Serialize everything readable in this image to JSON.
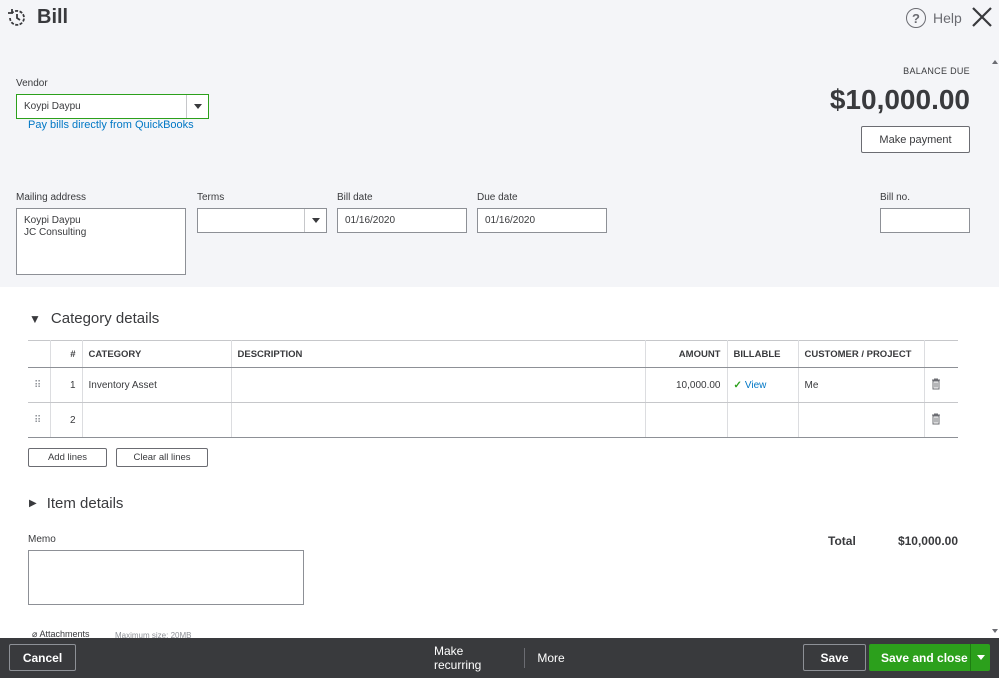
{
  "header": {
    "title": "Bill",
    "help_label": "Help"
  },
  "vendor": {
    "label": "Vendor",
    "value": "Koypi Daypu",
    "pay_link": "Pay bills directly from QuickBooks"
  },
  "balance": {
    "label": "BALANCE DUE",
    "amount": "$10,000.00",
    "make_payment": "Make payment"
  },
  "mailing": {
    "label": "Mailing address",
    "line1": "Koypi Daypu",
    "line2": "JC Consulting"
  },
  "terms": {
    "label": "Terms",
    "value": ""
  },
  "bill_date": {
    "label": "Bill date",
    "value": "01/16/2020"
  },
  "due_date": {
    "label": "Due date",
    "value": "01/16/2020"
  },
  "bill_no": {
    "label": "Bill no.",
    "value": ""
  },
  "category": {
    "title": "Category details",
    "headers": {
      "num": "#",
      "category": "CATEGORY",
      "description": "DESCRIPTION",
      "amount": "AMOUNT",
      "billable": "BILLABLE",
      "customer": "CUSTOMER / PROJECT"
    },
    "rows": [
      {
        "num": "1",
        "category": "Inventory Asset",
        "description": "",
        "amount": "10,000.00",
        "billable": "View",
        "customer": "Me"
      },
      {
        "num": "2",
        "category": "",
        "description": "",
        "amount": "",
        "billable": "",
        "customer": ""
      }
    ],
    "add_lines": "Add lines",
    "clear_lines": "Clear all lines"
  },
  "item": {
    "title": "Item details"
  },
  "memo": {
    "label": "Memo"
  },
  "total": {
    "label": "Total",
    "value": "$10,000.00"
  },
  "attachments": {
    "label": "Attachments",
    "hint": "Maximum size: 20MB"
  },
  "footer": {
    "cancel": "Cancel",
    "recurring": "Make recurring",
    "more": "More",
    "save": "Save",
    "save_close": "Save and close"
  },
  "colors": {
    "accent_green": "#2ca01c",
    "link_blue": "#0077c5",
    "footer_bg": "#393a3d"
  }
}
